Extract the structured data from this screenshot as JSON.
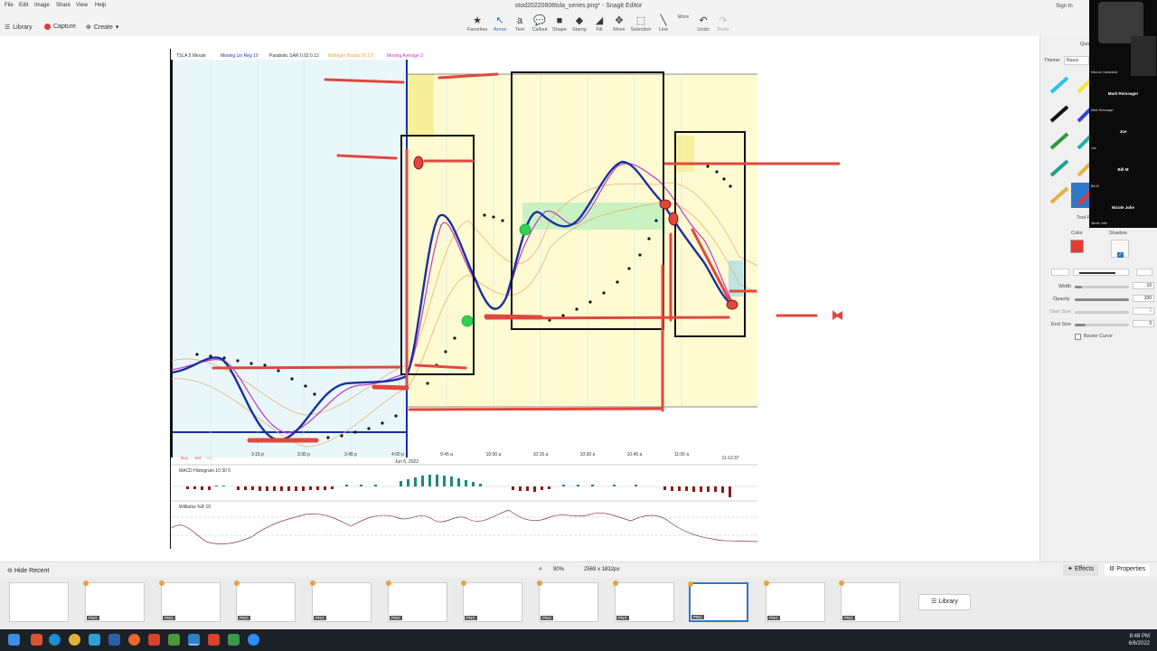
{
  "menu": [
    "File",
    "Edit",
    "Image",
    "Share",
    "View",
    "Help"
  ],
  "window_title": "stod20220606tsla_series.png* - Snagit Editor",
  "sign_in": "Sign In",
  "left_buttons": {
    "library": "Library",
    "capture": "Capture",
    "create": "Create"
  },
  "tools": [
    {
      "label": "Favorites",
      "icon": "star-icon",
      "glyph": "★"
    },
    {
      "label": "Arrow",
      "icon": "arrow-tool-icon",
      "glyph": "↖",
      "active": true
    },
    {
      "label": "Text",
      "icon": "text-tool-icon",
      "glyph": "a"
    },
    {
      "label": "Callout",
      "icon": "callout-icon",
      "glyph": "💬"
    },
    {
      "label": "Shape",
      "icon": "shape-icon",
      "glyph": "■"
    },
    {
      "label": "Stamp",
      "icon": "stamp-icon",
      "glyph": "◆"
    },
    {
      "label": "Fill",
      "icon": "fill-icon",
      "glyph": "◢"
    },
    {
      "label": "Move",
      "icon": "move-icon",
      "glyph": "✥"
    },
    {
      "label": "Selection",
      "icon": "selection-icon",
      "glyph": "⬚"
    },
    {
      "label": "Line",
      "icon": "line-icon",
      "glyph": "╲"
    },
    {
      "label": "More",
      "icon": "more-icon",
      "glyph": ""
    },
    {
      "label": "Undo",
      "icon": "undo-icon",
      "glyph": "↶"
    },
    {
      "label": "Redo",
      "icon": "redo-icon",
      "glyph": "↷",
      "disabled": true
    }
  ],
  "chart": {
    "legend": [
      "TSLA 5 Minute",
      "Moving Lin Reg 10",
      "Parabolic SAR 0.02 0.12",
      "Bollinger Bands 20 2.5",
      "Moving Average 3"
    ],
    "legend_colors": [
      "#333333",
      "#2233aa",
      "#333333",
      "#e8a23a",
      "#c03ac0"
    ],
    "x_ticks": [
      "3:15 p",
      "3:30 p",
      "3:45 p",
      "4:00 p",
      "9:45 a",
      "10:00 a",
      "10:15 a",
      "10:30 a",
      "10:45 a",
      "11:00 a"
    ],
    "date_label": "Jun 6, 2022",
    "end_label": "11:12:37",
    "buy_sell": [
      "Buy",
      "Sell",
      "Opt"
    ],
    "macd_label": "MACD Histogram 10 30 5",
    "williams_label": "Williams %R 10"
  },
  "props": {
    "quick_styles": "Quick Styles",
    "theme_label": "Theme:",
    "theme_value": "Basic",
    "tool_props": "Tool Properties",
    "color": "Color",
    "shadow": "Shadow",
    "width_label": "Width",
    "width_value": "10",
    "opacity_label": "Opacity",
    "opacity_value": "100",
    "start_label": "Start Size",
    "start_value": "3",
    "end_label": "End Size",
    "end_value": "3",
    "bezier": "Bezier Curve",
    "accent": "#e53935"
  },
  "participants": [
    {
      "name": "Marcus Castaneda"
    },
    {
      "name": "Mark Reinsager",
      "sub": "Mark Reinsager"
    },
    {
      "name": "Joe",
      "sub": "Joe"
    },
    {
      "name": "Bill M",
      "sub": "Bill M"
    },
    {
      "name": "Nicole Jolie",
      "sub": "Nicole Jolie"
    }
  ],
  "statusbar": {
    "hide_recent": "Hide Recent",
    "zoom": "90%",
    "dimensions": "2569 x 1832px",
    "effects": "Effects",
    "properties": "Properties"
  },
  "tray": {
    "library": "Library",
    "tag": "PNG"
  },
  "clock": {
    "time": "8:48 PM",
    "date": "6/6/2022"
  }
}
